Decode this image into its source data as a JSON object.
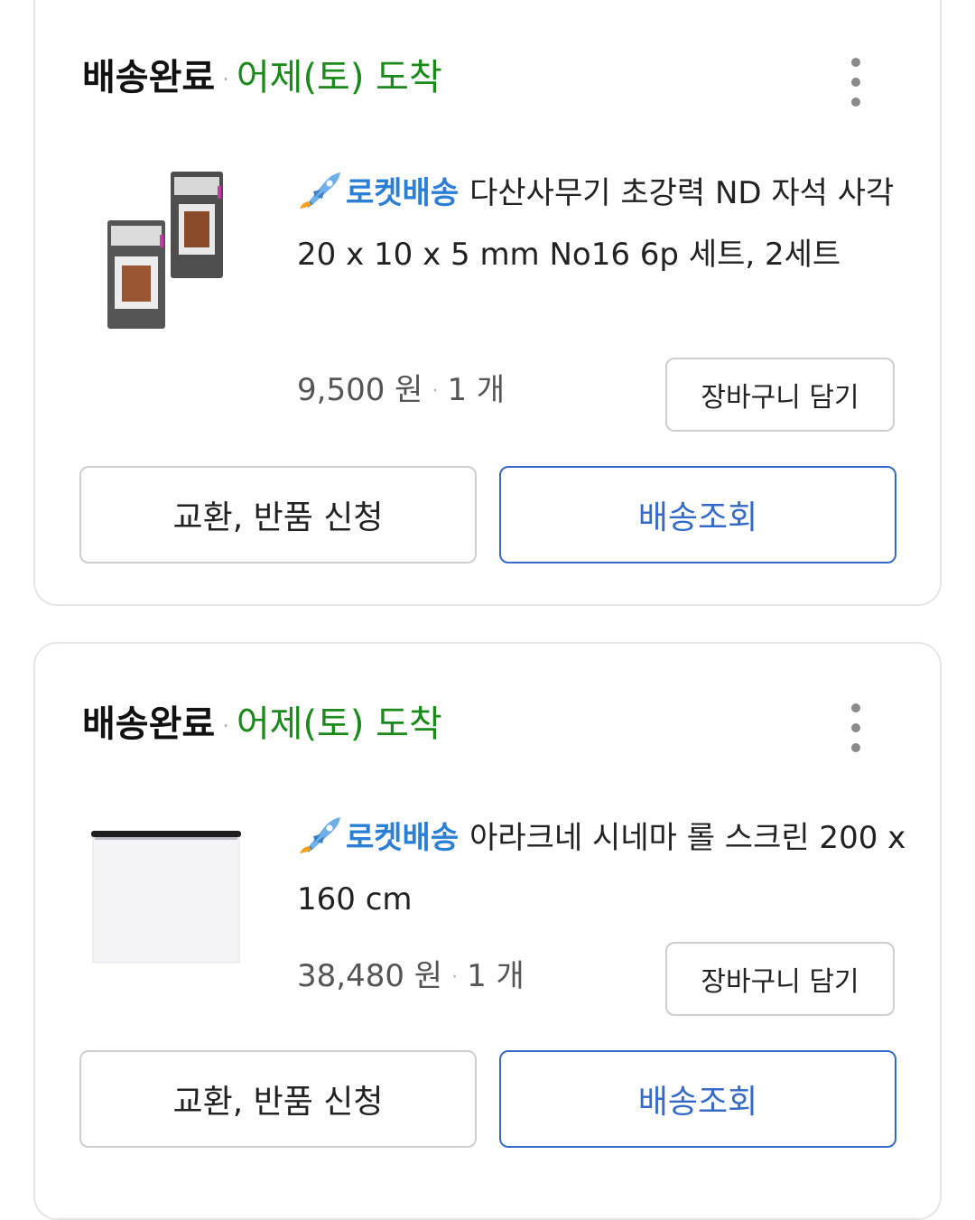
{
  "colors": {
    "arrival_green": "#1a8a1a",
    "rocket_blue": "#2c7fd6",
    "track_button_blue": "#346aca",
    "border_gray": "#cfcfcf",
    "card_border": "#e6e6e6"
  },
  "orders": [
    {
      "status": "배송완료",
      "separator": "·",
      "arrival": "어제(토) 도착",
      "menu_icon": "more-vertical-icon",
      "image_icon": "magnet-product-image",
      "rocket_icon": "rocket-icon",
      "rocket_label": "로켓배송",
      "product_name": "다산사무기 초강력 ND 자석 사각 20 x 10 x 5 mm No16 6p 세트, 2세트",
      "price": "9,500 원",
      "quantity": "1 개",
      "cart_button": "장바구니 담기",
      "exchange_button": "교환, 반품 신청",
      "track_button": "배송조회"
    },
    {
      "status": "배송완료",
      "separator": "·",
      "arrival": "어제(토) 도착",
      "menu_icon": "more-vertical-icon",
      "image_icon": "roll-screen-product-image",
      "rocket_icon": "rocket-icon",
      "rocket_label": "로켓배송",
      "product_name": "아라크네 시네마 롤 스크린 200 x 160 cm",
      "price": "38,480 원",
      "quantity": "1 개",
      "cart_button": "장바구니 담기",
      "exchange_button": "교환, 반품 신청",
      "track_button": "배송조회"
    }
  ]
}
